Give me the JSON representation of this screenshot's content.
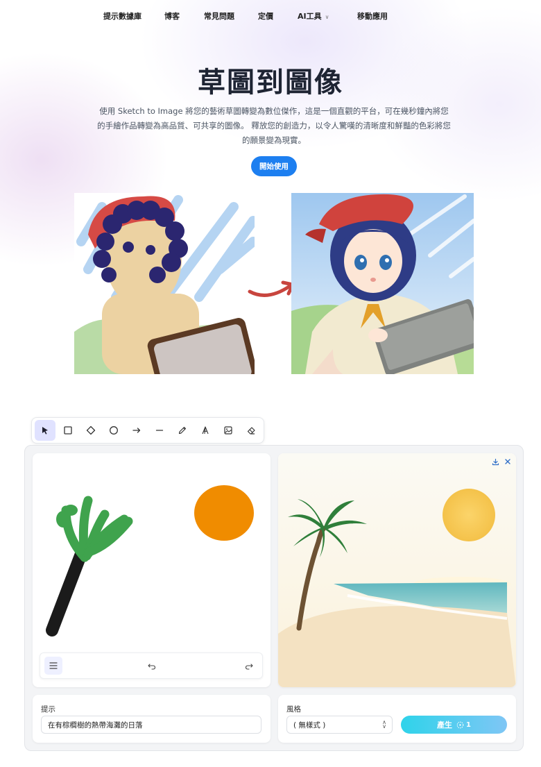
{
  "nav": {
    "items": [
      {
        "label": "提示數據庫"
      },
      {
        "label": "博客"
      },
      {
        "label": "常見問題"
      },
      {
        "label": "定價"
      },
      {
        "label": "AI工具"
      },
      {
        "label": "移動應用"
      }
    ]
  },
  "hero": {
    "title": "草圖到圖像",
    "description": "使用 Sketch to Image 將您的藝術草圖轉變為數位傑作，這是一個直觀的平台，可在幾秒鐘內將您的手繪作品轉變為高品質、可共享的圖像。 釋放您的創造力，以令人驚嘆的清晰度和鮮豔的色彩將您的願景變為現實。",
    "cta_label": "開始使用"
  },
  "toolbar": {
    "tools": [
      {
        "icon": "pointer-icon",
        "active": true
      },
      {
        "icon": "rectangle-icon",
        "active": false
      },
      {
        "icon": "diamond-icon",
        "active": false
      },
      {
        "icon": "circle-icon",
        "active": false
      },
      {
        "icon": "arrow-icon",
        "active": false
      },
      {
        "icon": "line-icon",
        "active": false
      },
      {
        "icon": "pencil-icon",
        "active": false
      },
      {
        "icon": "text-icon",
        "active": false
      },
      {
        "icon": "image-icon",
        "active": false
      },
      {
        "icon": "eraser-icon",
        "active": false
      }
    ]
  },
  "editor": {
    "prompt_label": "提示",
    "prompt_value": "在有棕櫚樹的熱帶海灘的日落",
    "style_label": "風格",
    "style_value": "( 無樣式 )",
    "generate_label": "產生",
    "credit_cost": "1"
  },
  "colors": {
    "accent": "#1d7ff0",
    "generate_start": "#2fd3ea",
    "generate_end": "#7fc6f5",
    "palm_leaf": "#3fa34d",
    "sun": "#f08c00"
  }
}
